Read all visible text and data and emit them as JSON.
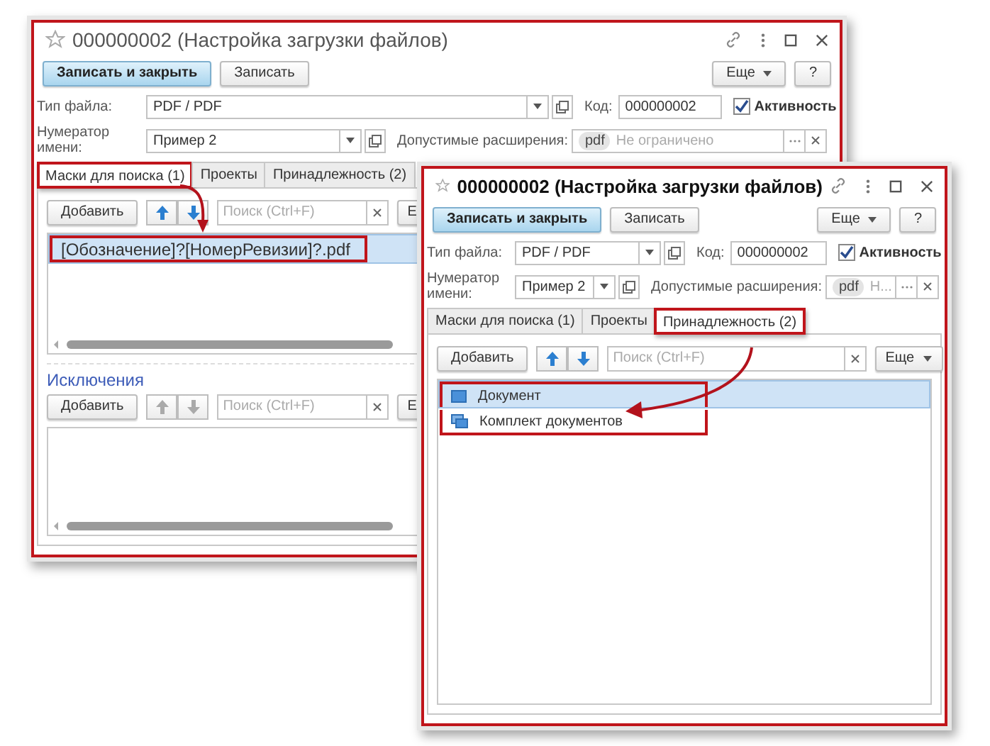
{
  "windows": [
    {
      "title": "000000002 (Настройка загрузки файлов)",
      "focused": false,
      "buttons": [
        {
          "label": "Записать и закрыть",
          "kind": "primary"
        },
        {
          "label": "Записать",
          "kind": "plain"
        }
      ],
      "menu_buttons": [
        {
          "label": "Еще",
          "kind": "menu"
        },
        {
          "label": "?",
          "kind": "plain"
        }
      ],
      "file_type": {
        "label": "Тип файла:",
        "value": "PDF / PDF"
      },
      "code": {
        "label": "Код:",
        "value": "000000002"
      },
      "active": {
        "label": "Активность",
        "checked": true
      },
      "numerator": {
        "label": "Нумератор имени:",
        "value": "Пример 2"
      },
      "extensions": {
        "label": "Допустимые расширения:",
        "tag": "pdf",
        "placeholder": "Не ограничено"
      },
      "tabs": [
        {
          "label": "Маски для поиска (1)",
          "selected": true,
          "highlighted": true
        },
        {
          "label": "Проекты",
          "selected": false,
          "highlighted": false
        },
        {
          "label": "Принадлежность (2)",
          "selected": false,
          "highlighted": false
        }
      ],
      "lists": [
        {
          "add": "Добавить",
          "arrows_disabled": false,
          "search_placeholder": "Поиск (Ctrl+F)",
          "more": "Е",
          "highlighted": true,
          "rows": [
            {
              "text": "[Обозначение]?[НомерРевизии]?.pdf",
              "kind": "text",
              "selected": true
            }
          ]
        },
        {
          "title": "Исключения",
          "add": "Добавить",
          "arrows_disabled": true,
          "search_placeholder": "Поиск (Ctrl+F)",
          "more": "Е"
        }
      ]
    },
    {
      "title": "000000002 (Настройка загрузки файлов)",
      "focused": true,
      "buttons": [
        {
          "label": "Записать и закрыть",
          "kind": "primary"
        },
        {
          "label": "Записать",
          "kind": "plain"
        }
      ],
      "menu_buttons": [
        {
          "label": "Еще",
          "kind": "menu"
        },
        {
          "label": "?",
          "kind": "plain"
        }
      ],
      "file_type": {
        "label": "Тип файла:",
        "value": "PDF / PDF"
      },
      "code": {
        "label": "Код:",
        "value": "000000002"
      },
      "active": {
        "label": "Активность",
        "checked": true
      },
      "numerator": {
        "label": "Нумератор имени:",
        "value": "Пример 2"
      },
      "extensions": {
        "label": "Допустимые расширения:",
        "tag": "pdf",
        "placeholder": "Н..."
      },
      "tabs": [
        {
          "label": "Маски для поиска (1)",
          "selected": false,
          "highlighted": false
        },
        {
          "label": "Проекты",
          "selected": false,
          "highlighted": false
        },
        {
          "label": "Принадлежность (2)",
          "selected": true,
          "highlighted": true
        }
      ],
      "lists": [
        {
          "add": "Добавить",
          "arrows_disabled": false,
          "search_placeholder": "Поиск (Ctrl+F)",
          "more": "Еще",
          "more_menu": true,
          "highlighted": true,
          "rows": [
            {
              "text": "Документ",
              "kind": "document",
              "selected": true
            },
            {
              "text": "Комплект документов",
              "kind": "document-set",
              "selected": false
            }
          ]
        }
      ]
    }
  ]
}
